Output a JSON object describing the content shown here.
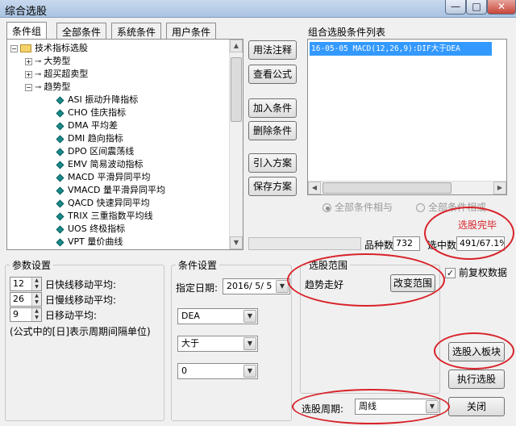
{
  "window": {
    "title": "综合选股",
    "minimize_glyph": "—",
    "maximize_glyph": "□",
    "close_glyph": "✕"
  },
  "tabs": [
    "条件组",
    "全部条件",
    "系统条件",
    "用户条件"
  ],
  "tree": {
    "root_label": "技术指标选股",
    "categories": [
      "大势型",
      "超买超卖型",
      "趋势型"
    ],
    "items": [
      "ASI 振动升降指标",
      "CHO 佳庆指标",
      "DMA 平均差",
      "DMI 趋向指标",
      "DPO 区间震荡线",
      "EMV 简易波动指标",
      "MACD 平滑异同平均",
      "VMACD 量平滑异同平均",
      "QACD 快速异同平均",
      "TRIX 三重指数平均线",
      "UOS 终极指标",
      "VPT 量价曲线"
    ]
  },
  "middle_buttons": [
    "用法注释",
    "查看公式",
    "加入条件",
    "删除条件",
    "引入方案",
    "保存方案"
  ],
  "condition_list": {
    "title": "组合选股条件列表",
    "items": [
      "16-05-05 MACD(12,26,9):DIF大于DEA"
    ]
  },
  "combine_mode": {
    "all_and": "全部条件相与",
    "all_or": "全部条件相或",
    "selected": "all_and"
  },
  "status": {
    "done_text": "选股完毕",
    "count_label": "品种数",
    "count_value": "732",
    "selected_label": "选中数",
    "selected_value": "491/67.1%"
  },
  "params": {
    "title": "参数设置",
    "rows": [
      {
        "value": "12",
        "label": "日快线移动平均:"
      },
      {
        "value": "26",
        "label": "日慢线移动平均:"
      },
      {
        "value": "9",
        "label": "日移动平均:"
      }
    ],
    "note": "(公式中的[日]表示周期间隔单位)"
  },
  "conditions": {
    "title": "条件设置",
    "date_label": "指定日期:",
    "date_value": "2016/ 5/ 5",
    "line": "DEA",
    "operator": "大于",
    "value": "0"
  },
  "range": {
    "title": "选股范围",
    "value": "趋势走好",
    "change_button": "改变范围"
  },
  "options": {
    "fq_label": "前复权数据",
    "fq_checked": true
  },
  "period": {
    "label": "选股周期:",
    "value": "周线"
  },
  "right_buttons": {
    "to_block": "选股入板块",
    "execute": "执行选股",
    "close": "关闭"
  },
  "icons": {
    "expand": "+",
    "collapse": "−",
    "key": "⊸",
    "dropdown": "▼",
    "up": "▲",
    "left": "◀",
    "right": "▶",
    "check": "✓"
  },
  "colors": {
    "selection": "#3399ff",
    "annotation": "#d8232a"
  }
}
